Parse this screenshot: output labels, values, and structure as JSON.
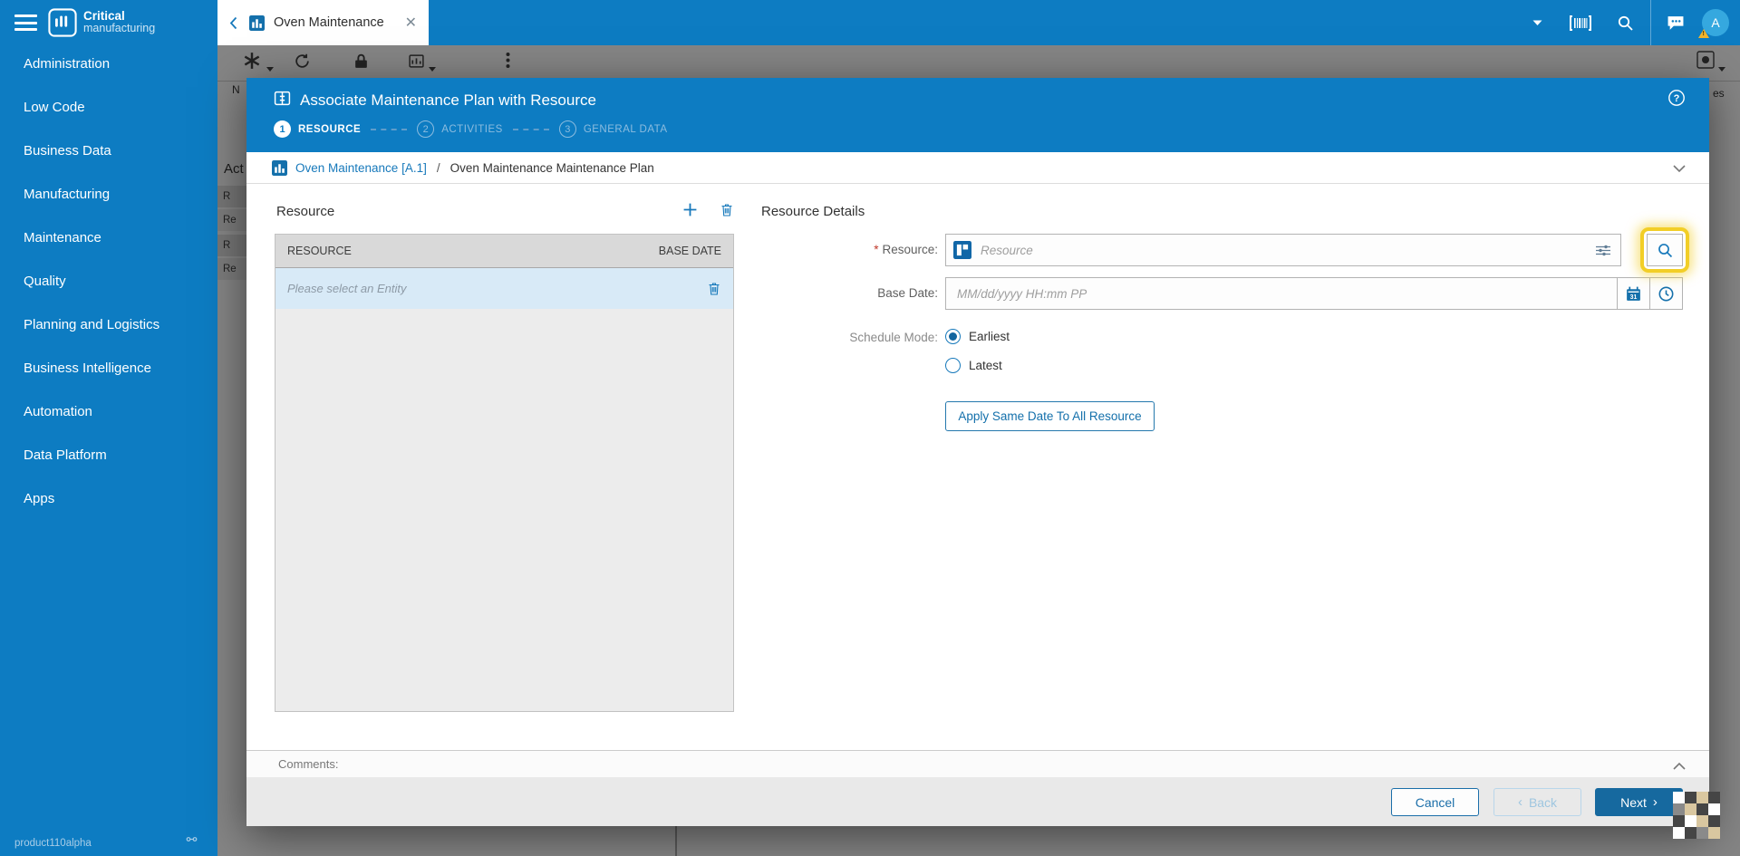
{
  "colors": {
    "accent": "#0d7cc2",
    "primary_button": "#16699f",
    "link": "#1779bb",
    "highlight": "#f2ce27",
    "selected_row": "#d8eaf7"
  },
  "icons": {
    "hamburger": "menu-icon",
    "logo": "critical-manufacturing-logo",
    "tab_entity": "bar-chart-box-icon",
    "caret": "chevron-down-icon",
    "barcode": "barcode-scanner-icon",
    "search": "magnifier-icon",
    "chat": "messages-icon",
    "avatar_warning": "warning-triangle-icon",
    "help": "question-circle-icon",
    "plus": "add-icon",
    "trash": "trash-icon",
    "sliders": "advanced-search-icon",
    "calendar": "calendar-icon",
    "clock": "clock-icon"
  },
  "sidebar": {
    "brand_bold": "Critical",
    "brand_light": "manufacturing",
    "items": [
      "Administration",
      "Low Code",
      "Business Data",
      "Manufacturing",
      "Maintenance",
      "Quality",
      "Planning and Logistics",
      "Business Intelligence",
      "Automation",
      "Data Platform",
      "Apps"
    ],
    "version": "product110alpha"
  },
  "topbar": {
    "tab_label": "Oven Maintenance",
    "avatar_initial": "A"
  },
  "background": {
    "toolbar_fragment": "N",
    "left_header": "Act",
    "left_rows": [
      "R",
      "Re",
      "R",
      "Re"
    ],
    "right_fragment": "es"
  },
  "modal": {
    "title": "Associate Maintenance Plan with Resource",
    "steps": [
      {
        "num": "1",
        "label": "RESOURCE"
      },
      {
        "num": "2",
        "label": "ACTIVITIES"
      },
      {
        "num": "3",
        "label": "GENERAL DATA"
      }
    ],
    "breadcrumb": {
      "parent": "Oven Maintenance [A.1]",
      "separator": "/",
      "current": "Oven Maintenance Maintenance Plan"
    },
    "resource_panel": {
      "title": "Resource",
      "col_resource": "RESOURCE",
      "col_base_date": "BASE DATE",
      "empty_row_text": "Please select an Entity"
    },
    "details": {
      "heading": "Resource Details",
      "required_marker": "*",
      "resource_label": "Resource:",
      "resource_placeholder": "Resource",
      "base_date_label": "Base Date:",
      "base_date_placeholder": "MM/dd/yyyy HH:mm PP",
      "schedule_mode_label": "Schedule Mode:",
      "option_earliest": "Earliest",
      "option_latest": "Latest",
      "apply_button": "Apply Same Date To All Resource"
    },
    "comments_label": "Comments:",
    "footer": {
      "cancel": "Cancel",
      "back": "Back",
      "next": "Next"
    }
  }
}
